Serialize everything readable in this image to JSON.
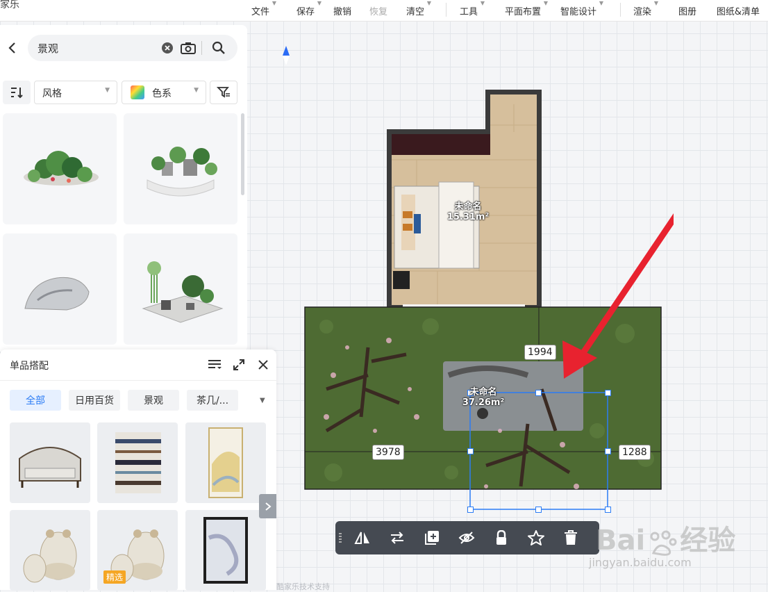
{
  "app": {
    "logo": "家乐"
  },
  "toolbar": {
    "file": "文件",
    "save": "保存",
    "undo": "撤销",
    "redo": "恢复",
    "clear": "清空",
    "tools": "工具",
    "layout": "平面布置",
    "smart": "智能设计",
    "render": "渲染",
    "album": "图册",
    "drawings": "图纸&清单"
  },
  "search": {
    "value": "景观"
  },
  "filters": {
    "style": "风格",
    "color": "色系"
  },
  "panel": {
    "title": "单品搭配",
    "chips": [
      "全部",
      "日用百货",
      "景观",
      "茶几/..."
    ],
    "badge": "精选"
  },
  "plan": {
    "room1": {
      "name": "未命名",
      "area": "15.31m²"
    },
    "room2": {
      "name": "未命名",
      "area": "37.26m²"
    },
    "dims": {
      "top": "1994",
      "left": "3978",
      "right": "1288"
    }
  },
  "watermark": {
    "brand": "Bai",
    "brand2": "du",
    "jy": "经验",
    "url": "jingyan.baidu.com"
  },
  "footer": {
    "text": "酷家乐技术支持"
  },
  "colors": {
    "accent": "#2b7cf5",
    "arrow": "#e8222f",
    "grass": "#4e6b33",
    "wood": "#d6bf9c",
    "wall": "#3b3b3b"
  }
}
